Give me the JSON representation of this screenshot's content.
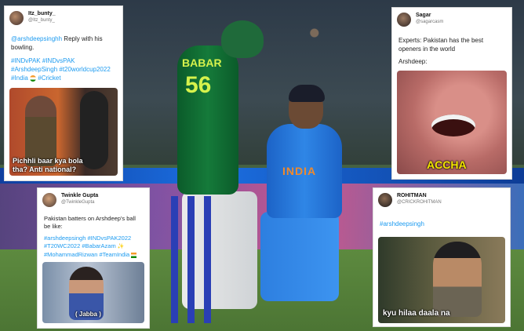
{
  "cards": {
    "c1": {
      "name": "Itz_bunty_",
      "handle": "@Itz_bunty_",
      "text_handle": "@arshdeepsinghh",
      "text": " Reply with his bowling.",
      "tags_line1": "#INDvPAK #INDvsPAK",
      "tags_line2": "#ArshdeepSingh #t20worldcup2022",
      "tags_line3_a": "#India",
      "tags_line3_b": "#Cricket",
      "meme_caption": "Pichhli baar kya bola\ntha? Anti national?"
    },
    "c2": {
      "name": "Sagar",
      "handle": "@sagarcasm",
      "text": "Experts: Pakistan has the best openers in the world",
      "text2": "Arshdeep:",
      "meme_caption": "ACCHA"
    },
    "c3": {
      "name": "Twinkle Gupta",
      "handle": "@TwinkleGupta",
      "text": "Pakistan batters on Arshdeep's ball be like:",
      "tags_line1": "#arshdeepsingh #INDvsPAK2022",
      "tags_line2": "#T20WC2022 #BabarAzam",
      "tags_line3": "#MohammadRizwan #TeamIndia",
      "meme_caption": "( Jabba )"
    },
    "c4": {
      "name": "ROHITMAN",
      "handle": "@CRICKROHITMAN",
      "text": "#arshdeepsingh",
      "meme_caption": "kyu hilaa daala na"
    }
  },
  "photo": {
    "player1_name": "BABAR",
    "player1_number": "56",
    "player2_shirt": "INDIA"
  }
}
